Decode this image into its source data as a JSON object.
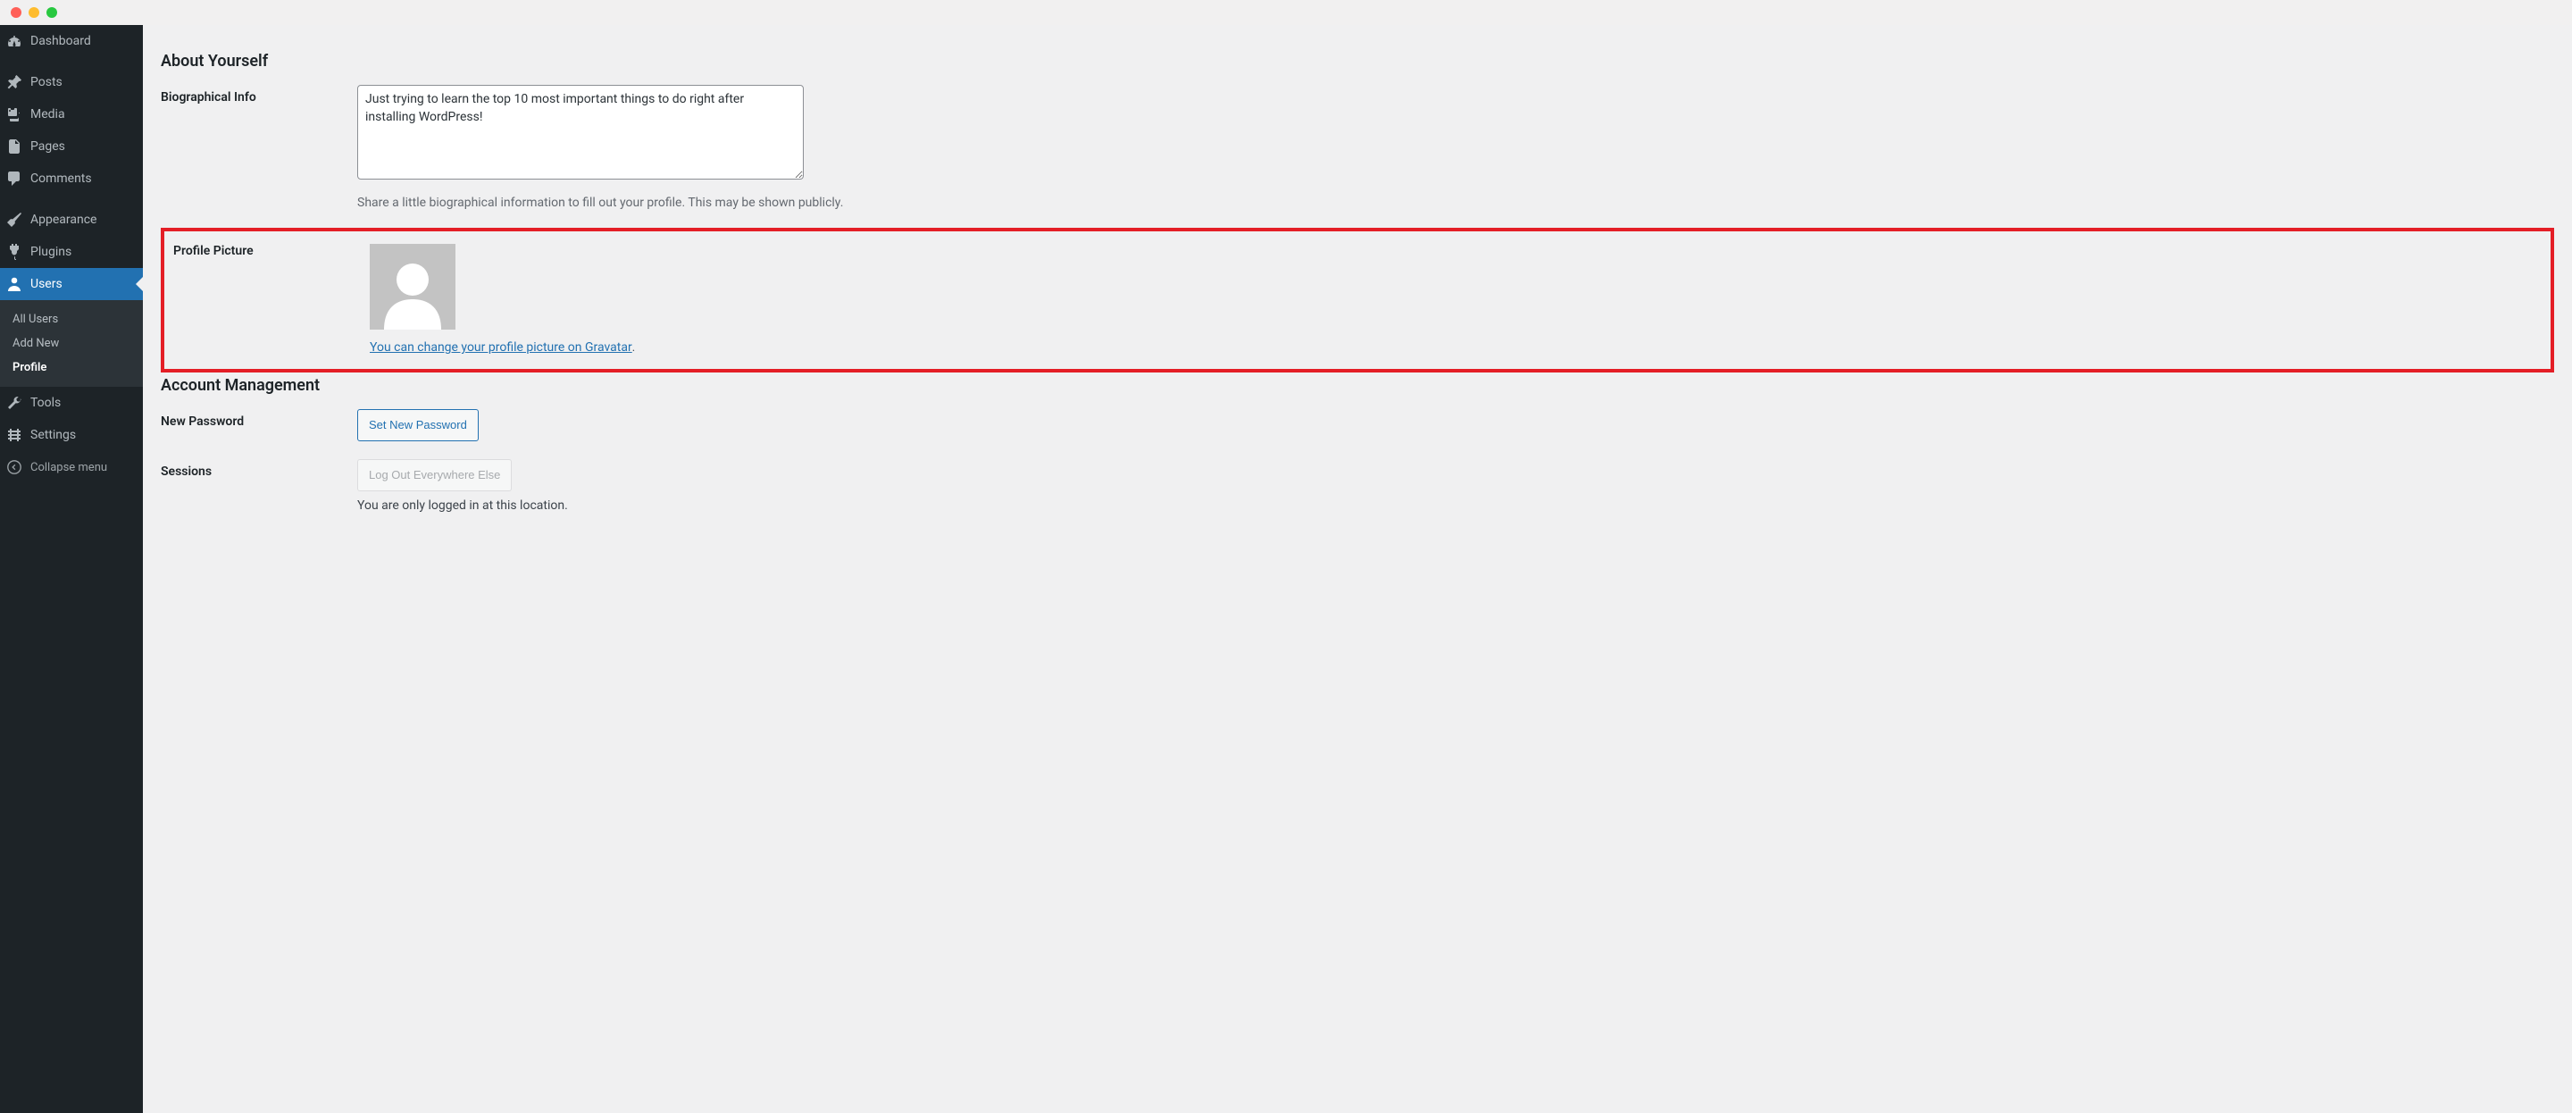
{
  "sidebar": {
    "items": [
      {
        "icon": "dashboard",
        "label": "Dashboard"
      },
      {
        "icon": "pin",
        "label": "Posts"
      },
      {
        "icon": "media",
        "label": "Media"
      },
      {
        "icon": "page",
        "label": "Pages"
      },
      {
        "icon": "comment",
        "label": "Comments"
      },
      {
        "icon": "brush",
        "label": "Appearance"
      },
      {
        "icon": "plug",
        "label": "Plugins"
      },
      {
        "icon": "user",
        "label": "Users"
      },
      {
        "icon": "wrench",
        "label": "Tools"
      },
      {
        "icon": "settings",
        "label": "Settings"
      }
    ],
    "submenu": {
      "items": [
        "All Users",
        "Add New",
        "Profile"
      ],
      "active": "Profile"
    },
    "collapse_label": "Collapse menu"
  },
  "about": {
    "heading": "About Yourself",
    "bio_label": "Biographical Info",
    "bio_value": "Just trying to learn the top 10 most important things to do right after installing WordPress!",
    "bio_description": "Share a little biographical information to fill out your profile. This may be shown publicly.",
    "picture_label": "Profile Picture",
    "gravatar_link_text": "You can change your profile picture on Gravatar",
    "period": "."
  },
  "account": {
    "heading": "Account Management",
    "new_password_label": "New Password",
    "set_password_button": "Set New Password",
    "sessions_label": "Sessions",
    "logout_button": "Log Out Everywhere Else",
    "sessions_description": "You are only logged in at this location."
  }
}
